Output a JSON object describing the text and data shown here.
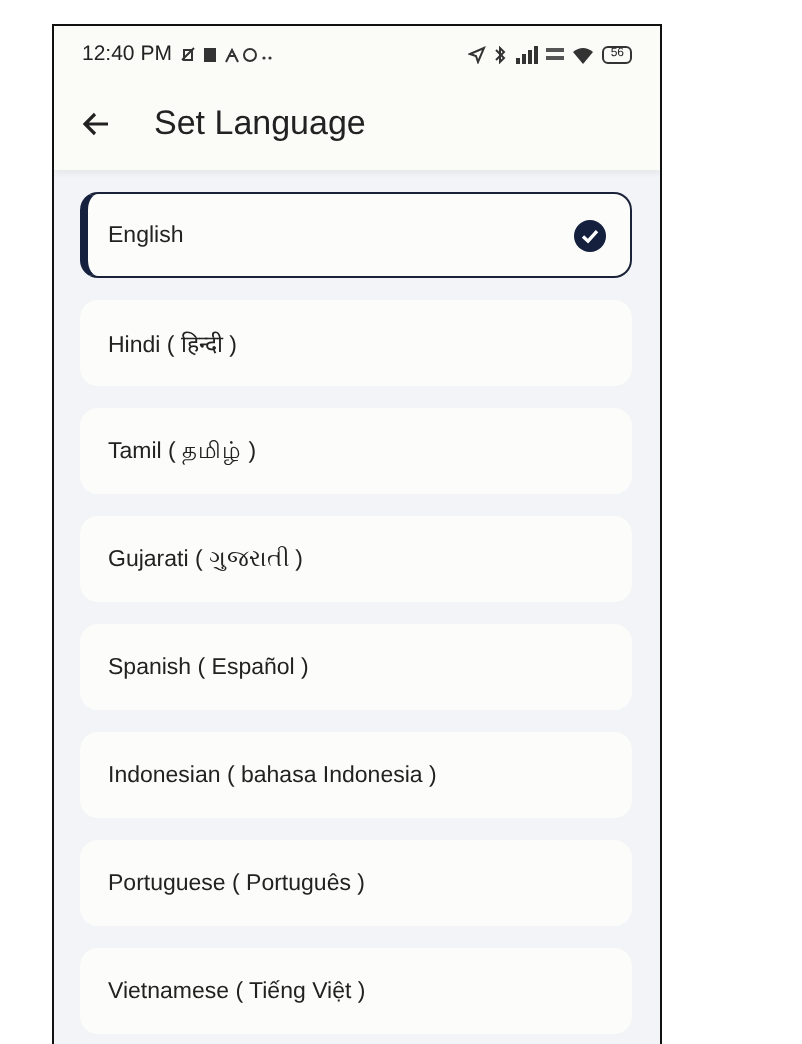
{
  "status_bar": {
    "time": "12:40 PM",
    "battery": "56"
  },
  "header": {
    "title": "Set Language"
  },
  "languages": [
    {
      "label": "English",
      "selected": true
    },
    {
      "label": "Hindi ( हिन्दी )",
      "selected": false
    },
    {
      "label": "Tamil ( தமிழ் )",
      "selected": false
    },
    {
      "label": "Gujarati ( ગુજરાતી )",
      "selected": false
    },
    {
      "label": "Spanish ( Español )",
      "selected": false
    },
    {
      "label": "Indonesian ( bahasa Indonesia )",
      "selected": false
    },
    {
      "label": "Portuguese ( Português )",
      "selected": false
    },
    {
      "label": "Vietnamese ( Tiếng Việt )",
      "selected": false
    }
  ]
}
